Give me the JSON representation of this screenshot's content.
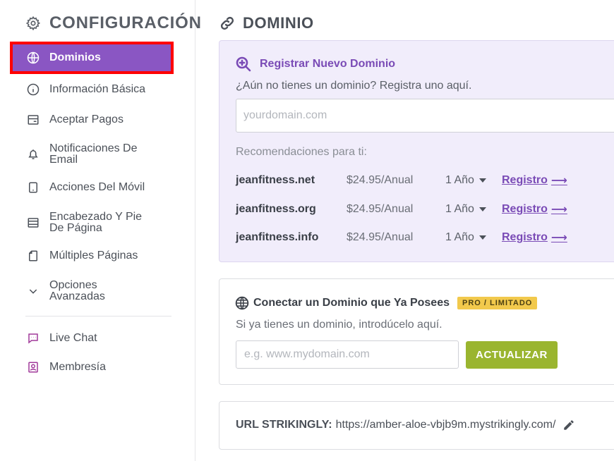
{
  "sidebar": {
    "title": "CONFIGURACIÓN",
    "items": [
      {
        "label": "Dominios",
        "icon": "globe-icon"
      },
      {
        "label": "Información Básica",
        "icon": "info-icon"
      },
      {
        "label": "Aceptar Pagos",
        "icon": "payment-icon"
      },
      {
        "label": "Notificaciones De Email",
        "icon": "bell-icon"
      },
      {
        "label": "Acciones Del Móvil",
        "icon": "mobile-icon"
      },
      {
        "label": "Encabezado Y Pie De Página",
        "icon": "header-footer-icon"
      },
      {
        "label": "Múltiples Páginas",
        "icon": "pages-icon"
      },
      {
        "label": "Opciones Avanzadas",
        "icon": "chevron-down-icon"
      }
    ],
    "extra_items": [
      {
        "label": "Live Chat",
        "icon": "chat-icon"
      },
      {
        "label": "Membresía",
        "icon": "membership-icon"
      }
    ]
  },
  "main": {
    "title": "DOMINIO",
    "register": {
      "heading": "Registrar Nuevo Dominio",
      "subtitle": "¿Aún no tienes un dominio? Registra uno aquí.",
      "placeholder": "yourdomain.com",
      "recommend_label": "Recomendaciones para ti:",
      "recommendations": [
        {
          "domain": "jeanfitness.net",
          "price": "$24.95/Anual",
          "period": "1 Año",
          "action": "Registro"
        },
        {
          "domain": "jeanfitness.org",
          "price": "$24.95/Anual",
          "period": "1 Año",
          "action": "Registro"
        },
        {
          "domain": "jeanfitness.info",
          "price": "$24.95/Anual",
          "period": "1 Año",
          "action": "Registro"
        }
      ]
    },
    "connect": {
      "heading": "Conectar un Dominio que Ya Posees",
      "badge": "PRO / LIMITADO",
      "subtitle": "Si ya tienes un dominio, introdúcelo aquí.",
      "placeholder": "e.g. www.mydomain.com",
      "button": "ACTUALIZAR"
    },
    "url": {
      "label": "URL STRIKINGLY:",
      "value": "https://amber-aloe-vbjb9m.mystrikingly.com/"
    }
  },
  "colors": {
    "accent": "#8a56c3",
    "link": "#7a4bb6",
    "button": "#9ab52f",
    "badge": "#f2c94c",
    "highlight_border": "#ff0000"
  }
}
